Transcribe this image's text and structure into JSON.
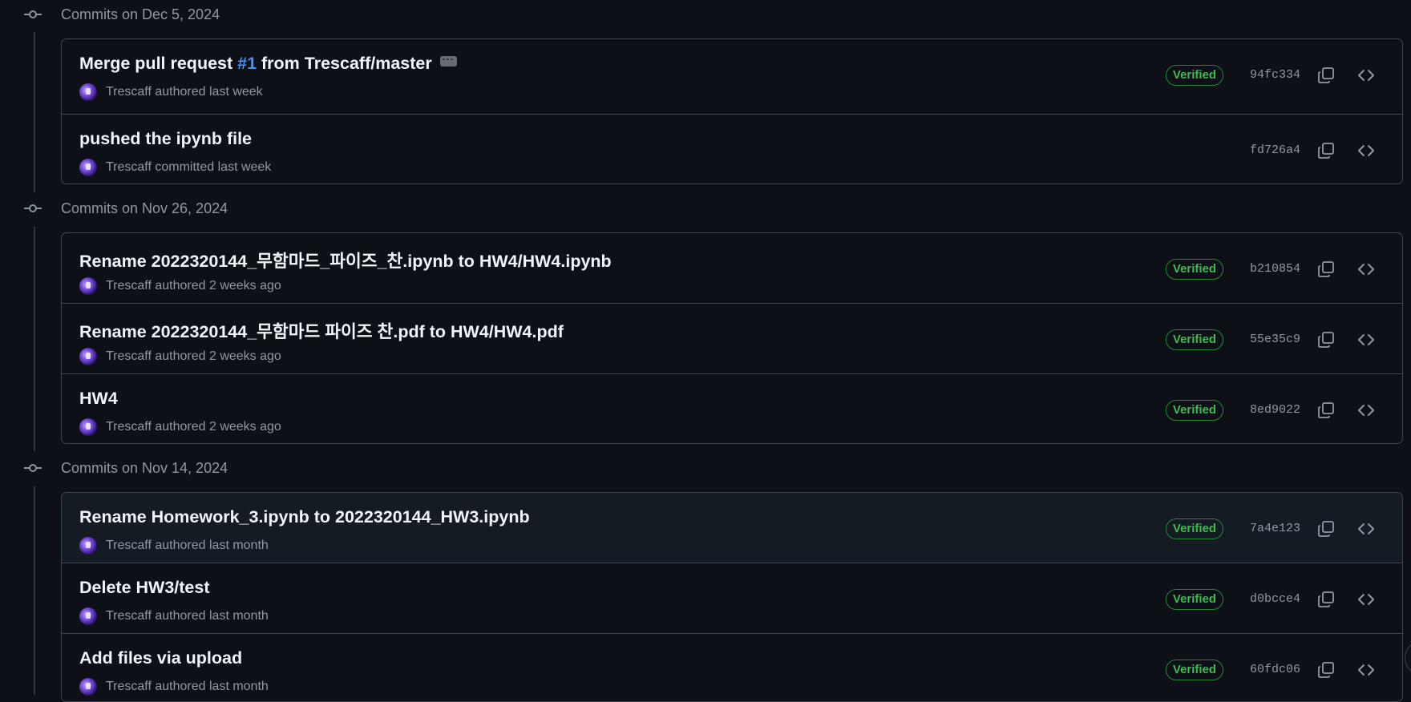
{
  "groups": [
    {
      "date": "Commits on Dec 5, 2024",
      "commits": [
        {
          "title_prefix": "Merge pull request ",
          "pr": "#1",
          "title_suffix": " from Trescaff/master",
          "author": "Trescaff",
          "action": "authored",
          "when": "last week",
          "verified": "Verified",
          "sha": "94fc334"
        },
        {
          "title": "pushed the ipynb file",
          "author": "Trescaff",
          "action": "committed",
          "when": "last week",
          "sha": "fd726a4"
        }
      ]
    },
    {
      "date": "Commits on Nov 26, 2024",
      "commits": [
        {
          "title": "Rename 2022320144_무함마드_파이즈_찬.ipynb to HW4/HW4.ipynb",
          "author": "Trescaff",
          "action": "authored",
          "when": "2 weeks ago",
          "verified": "Verified",
          "sha": "b210854"
        },
        {
          "title": "Rename 2022320144_무함마드 파이즈 찬.pdf to HW4/HW4.pdf",
          "author": "Trescaff",
          "action": "authored",
          "when": "2 weeks ago",
          "verified": "Verified",
          "sha": "55e35c9"
        },
        {
          "title": "HW4",
          "author": "Trescaff",
          "action": "authored",
          "when": "2 weeks ago",
          "verified": "Verified",
          "sha": "8ed9022"
        }
      ]
    },
    {
      "date": "Commits on Nov 14, 2024",
      "commits": [
        {
          "title": "Rename Homework_3.ipynb to 2022320144_HW3.ipynb",
          "author": "Trescaff",
          "action": "authored",
          "when": "last month",
          "verified": "Verified",
          "sha": "7a4e123"
        },
        {
          "title": "Delete HW3/test",
          "author": "Trescaff",
          "action": "authored",
          "when": "last month",
          "verified": "Verified",
          "sha": "d0bcce4"
        },
        {
          "title": "Add files via upload",
          "author": "Trescaff",
          "action": "authored",
          "when": "last month",
          "verified": "Verified",
          "sha": "60fdc06"
        }
      ]
    }
  ],
  "icons": {
    "commit": "git-commit-icon",
    "copy": "copy-icon",
    "browse": "code-icon",
    "more": "ellipsis-icon"
  },
  "colors": {
    "background": "#0d1117",
    "link": "#4493f8",
    "verified": "#3fb950",
    "border": "#3d444d"
  }
}
